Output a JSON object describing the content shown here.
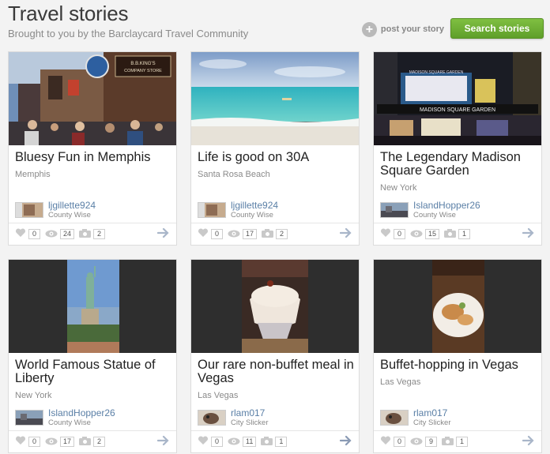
{
  "header": {
    "title": "Travel stories",
    "subtitle": "Brought to you by the Barclaycard Travel Community",
    "post_story_label": "post your story",
    "search_button_label": "Search stories"
  },
  "colors": {
    "accent_green": "#6cad33",
    "link_blue": "#5a7fa6"
  },
  "stories": [
    {
      "title": "Bluesy Fun in Memphis",
      "location": "Memphis",
      "author": "ljgillette924",
      "rank": "County Wise",
      "likes": "0",
      "views": "24",
      "photos": "2"
    },
    {
      "title": "Life is good on 30A",
      "location": "Santa Rosa Beach",
      "author": "ljgillette924",
      "rank": "County Wise",
      "likes": "0",
      "views": "17",
      "photos": "2"
    },
    {
      "title": "The Legendary Madison Square Garden",
      "location": "New York",
      "author": "IslandHopper26",
      "rank": "County Wise",
      "likes": "0",
      "views": "15",
      "photos": "1"
    },
    {
      "title": "World Famous Statue of Liberty",
      "location": "New York",
      "author": "IslandHopper26",
      "rank": "County Wise",
      "likes": "0",
      "views": "17",
      "photos": "2"
    },
    {
      "title": "Our rare non-buffet meal in Vegas",
      "location": "Las Vegas",
      "author": "rlam017",
      "rank": "City Slicker",
      "likes": "0",
      "views": "11",
      "photos": "1"
    },
    {
      "title": "Buffet-hopping in Vegas",
      "location": "Las Vegas",
      "author": "rlam017",
      "rank": "City Slicker",
      "likes": "0",
      "views": "9",
      "photos": "1"
    }
  ],
  "photo_texts": {
    "store_sign": "B.B.KING'S COMPANY STORE",
    "msg_marquee": "MADISON SQUARE GARDEN",
    "msg_sign": "MADISON SQUARE GARDEN"
  }
}
